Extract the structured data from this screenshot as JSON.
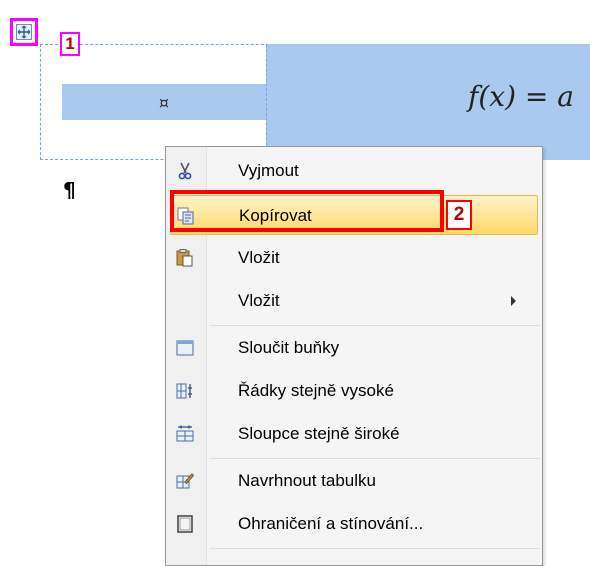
{
  "table": {
    "cell_marker": "¤",
    "formula": "f(x) = a",
    "paragraph_mark": "¶"
  },
  "callouts": {
    "one": "1",
    "two": "2"
  },
  "context_menu": {
    "items": [
      {
        "label": "Vyjmout",
        "icon": "scissors-icon"
      },
      {
        "label": "Kopírovat",
        "icon": "copy-icon",
        "highlighted": true
      },
      {
        "label": "Vložit",
        "icon": "paste-icon"
      },
      {
        "label": "Vložit",
        "icon": "",
        "submenu": true
      },
      {
        "label": "Sloučit buňky",
        "icon": "merge-cells-icon"
      },
      {
        "label": "Řádky stejně vysoké",
        "icon": "distribute-rows-icon"
      },
      {
        "label": "Sloupce stejně široké",
        "icon": "distribute-columns-icon"
      },
      {
        "label": "Navrhnout tabulku",
        "icon": "draw-table-icon"
      },
      {
        "label": "Ohraničení a stínování...",
        "icon": "borders-icon"
      }
    ]
  },
  "colors": {
    "cell_selection": "#a9c9ef",
    "callout_magenta": "#ff00ff",
    "callout_red": "#ff0000",
    "menu_hover": "#ffd968"
  }
}
